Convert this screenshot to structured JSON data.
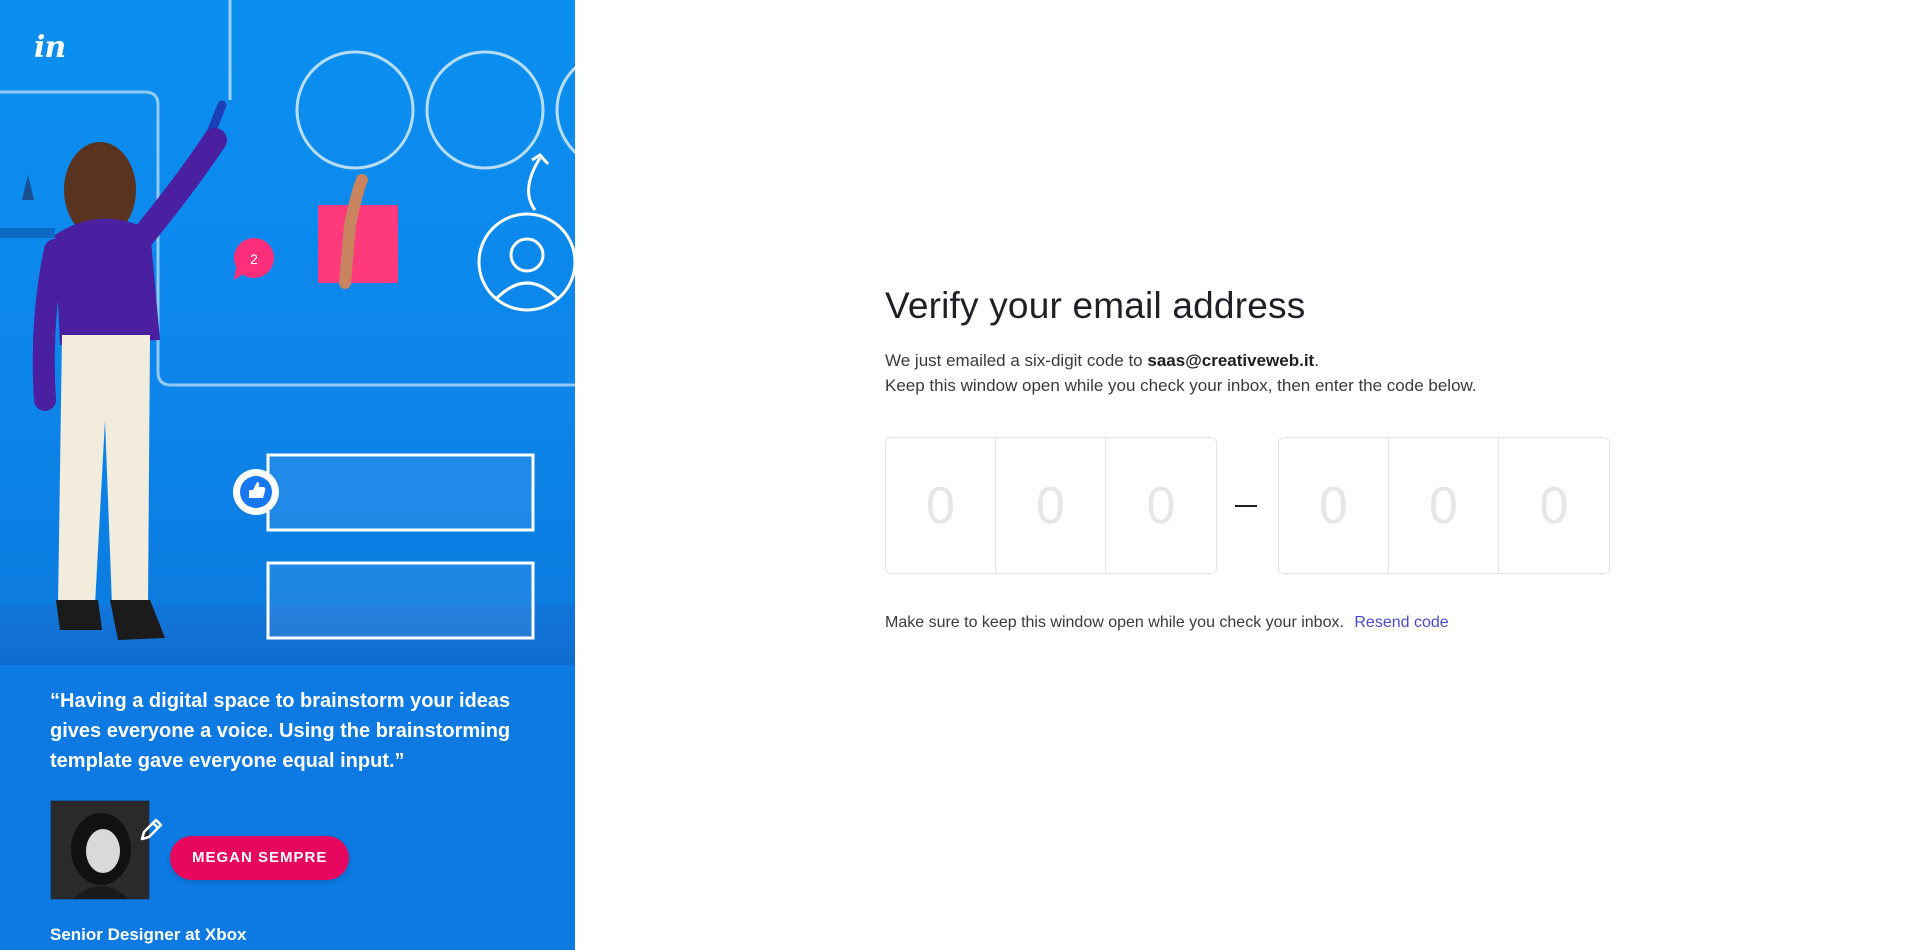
{
  "brand": {
    "logo_text": "in"
  },
  "hero": {
    "bubble_count": "2",
    "accent": "#e8075f",
    "background": "#0c7ae2"
  },
  "testimonial": {
    "quote": "“Having a digital space to brainstorm your ideas gives everyone a voice. Using the brainstorming template gave everyone equal input.”",
    "name": "MEGAN SEMPRE",
    "role": "Senior Designer at Xbox"
  },
  "verify": {
    "title": "Verify your email address",
    "desc_prefix": "We just emailed a six-digit code to ",
    "email": "saas@creativeweb.it",
    "desc_suffix": ".",
    "desc_line2": "Keep this window open while you check your inbox, then enter the code below.",
    "digit_placeholders": [
      "0",
      "0",
      "0",
      "0",
      "0",
      "0"
    ],
    "help_text": "Make sure to keep this window open while you check your inbox.",
    "resend_label": "Resend code",
    "link_color": "#4a4acb"
  }
}
